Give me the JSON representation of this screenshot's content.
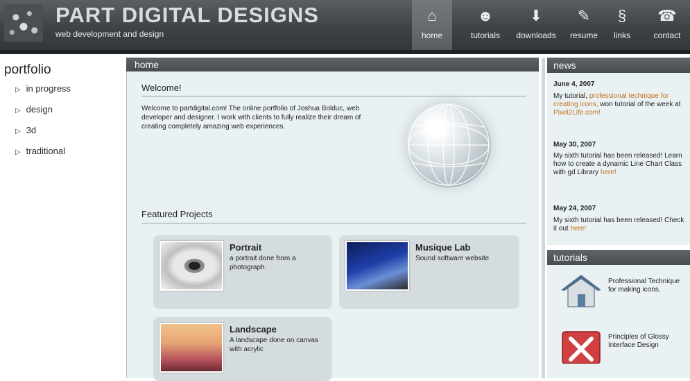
{
  "header": {
    "title": "PART DIGITAL DESIGNS",
    "tagline": "web development and design",
    "nav": [
      {
        "label": "home",
        "icon": "home-icon",
        "glyph": "⌂",
        "active": true
      },
      {
        "label": "tutorials",
        "icon": "person-icon",
        "glyph": "☻"
      },
      {
        "label": "downloads",
        "icon": "download-icon",
        "glyph": "⬇"
      },
      {
        "label": "resume",
        "icon": "pencil-icon",
        "glyph": "✎"
      },
      {
        "label": "links",
        "icon": "link-icon",
        "glyph": "§"
      },
      {
        "label": "contact",
        "icon": "phone-icon",
        "glyph": "☎"
      }
    ]
  },
  "sidebar": {
    "title": "portfolio",
    "items": [
      {
        "label": "in progress"
      },
      {
        "label": "design"
      },
      {
        "label": "3d"
      },
      {
        "label": "traditional"
      }
    ]
  },
  "main": {
    "heading": "home",
    "welcome_heading": "Welcome!",
    "welcome_text": "Welcome to partdigital.com! The online portfolio of Joshua Bolduc, web developer and designer. I work with clients to fully realize their dream of creating completely amazing web experiences.",
    "featured_heading": "Featured Projects",
    "projects": [
      {
        "title": "Portrait",
        "desc": "a portrait done from a photograph."
      },
      {
        "title": "Musique Lab",
        "desc": "Sound software website"
      },
      {
        "title": "Landscape",
        "desc": "A landscape done on canvas with acrylic"
      }
    ]
  },
  "news": {
    "heading": "news",
    "items": [
      {
        "date": "June 4, 2007",
        "text_before": "My tutorial, ",
        "link": "professional technique for creating icons,",
        "text_after": " won tutorial of the week at ",
        "link2": "Pixel2Life.com!"
      },
      {
        "date": "May 30, 2007",
        "text_before": "My sixth tutorial has been released! Learn how to create a dynamic Line Chart Class with gd Library ",
        "link": "here!"
      },
      {
        "date": "May 24, 2007",
        "text_before": "My sixth tutorial has been released! Check it out ",
        "link": "here!"
      }
    ]
  },
  "tutorials": {
    "heading": "tutorials",
    "items": [
      {
        "title": "Professional Technique for making icons.",
        "icon": "house-icon"
      },
      {
        "title": "Principles of Glossy Interface Design",
        "icon": "close-x-icon"
      }
    ]
  },
  "colors": {
    "header_bg": "#3e4346",
    "content_bg": "#e9f1f3",
    "link": "#c5701b"
  }
}
